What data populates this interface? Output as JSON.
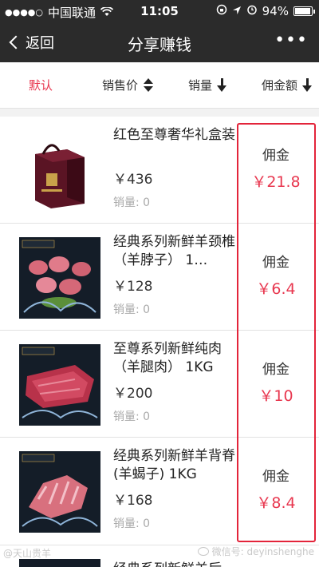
{
  "status_bar": {
    "carrier": "中国联通",
    "time": "11:05",
    "battery": "94%"
  },
  "nav": {
    "back_label": "返回",
    "title": "分享赚钱",
    "more": "•••"
  },
  "sort_bar": {
    "items": [
      {
        "label": "默认",
        "active": true
      },
      {
        "label": "销售价",
        "icon": "sort-updown-icon"
      },
      {
        "label": "销量",
        "icon": "arrow-down-icon"
      },
      {
        "label": "佣金额",
        "icon": "arrow-down-icon"
      }
    ]
  },
  "products": [
    {
      "name": "红色至尊奢华礼盒装",
      "price": "￥436",
      "sales": "销量: 0",
      "commission_label": "佣金",
      "commission": "￥21.8"
    },
    {
      "name": "经典系列新鲜羊颈椎（羊脖子） 1…",
      "price": "￥128",
      "sales": "销量: 0",
      "commission_label": "佣金",
      "commission": "￥6.4"
    },
    {
      "name": "至尊系列新鲜纯肉（羊腿肉） 1KG",
      "price": "￥200",
      "sales": "销量: 0",
      "commission_label": "佣金",
      "commission": "￥10"
    },
    {
      "name": "经典系列新鲜羊背脊(羊蝎子) 1KG",
      "price": "￥168",
      "sales": "销量: 0",
      "commission_label": "佣金",
      "commission": "￥8.4"
    }
  ],
  "partial_product": {
    "name": "经典系列新鲜羊后"
  },
  "watermark": {
    "left": "@天山贵羊",
    "right": "微信号: deyinshenghe"
  },
  "colors": {
    "bar_bg": "#2b2b2b",
    "accent_red": "#e8374f",
    "highlight_box": "#e3243a"
  }
}
